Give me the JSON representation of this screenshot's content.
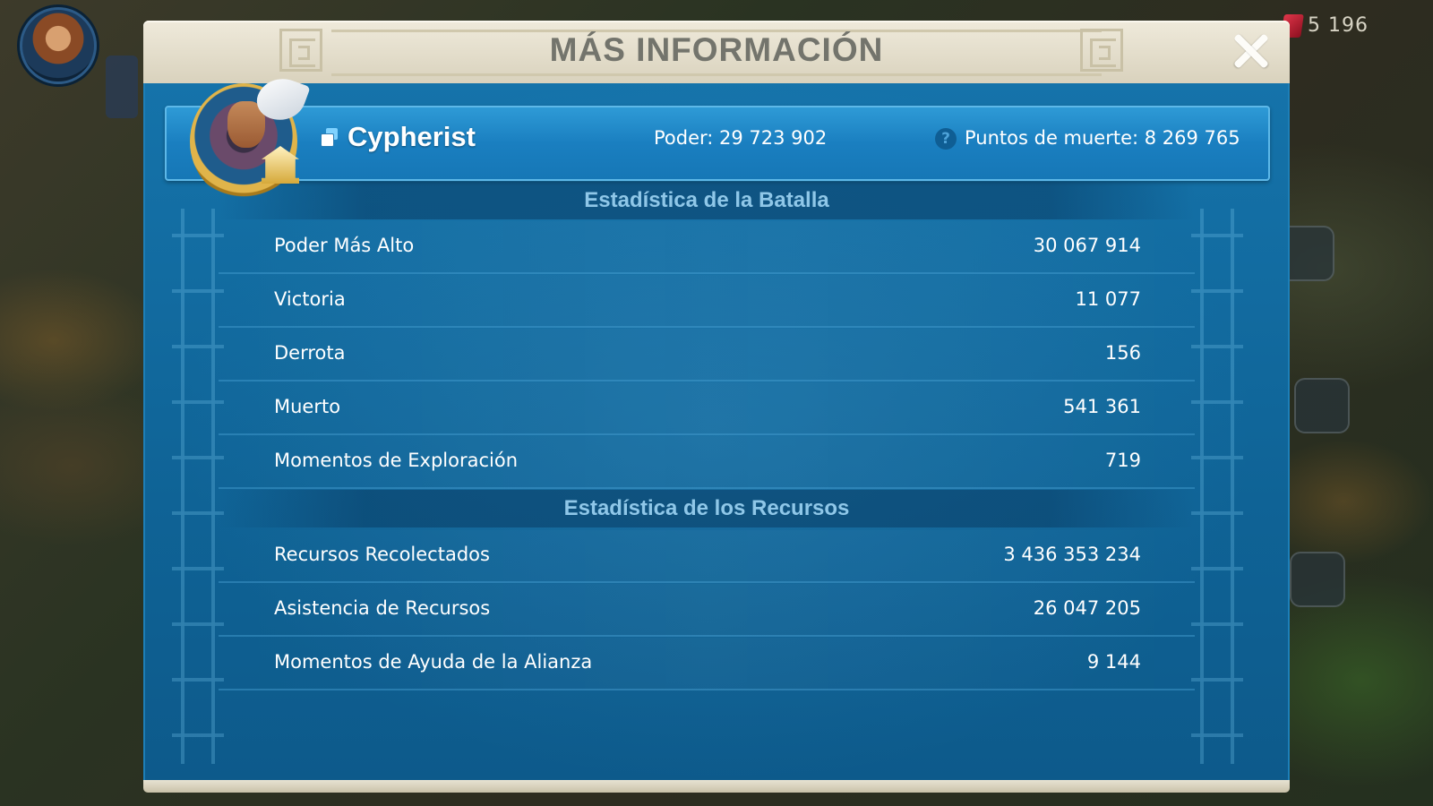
{
  "background": {
    "gem_count": "5 196"
  },
  "dialog": {
    "title": "MÁS INFORMACIÓN"
  },
  "player": {
    "name": "Cypherist",
    "power": "Poder: 29 723 902",
    "kill_points": "Puntos de muerte: 8 269 765",
    "info_icon_glyph": "?"
  },
  "battle_stats": {
    "header": "Estadística de la Batalla",
    "rows": [
      {
        "label": "Poder Más Alto",
        "value": "30 067 914"
      },
      {
        "label": "Victoria",
        "value": "11 077"
      },
      {
        "label": "Derrota",
        "value": "156"
      },
      {
        "label": "Muerto",
        "value": "541 361"
      },
      {
        "label": "Momentos de Exploración",
        "value": "719"
      }
    ]
  },
  "resource_stats": {
    "header": "Estadística de los Recursos",
    "rows": [
      {
        "label": "Recursos Recolectados",
        "value": "3 436 353 234"
      },
      {
        "label": "Asistencia de Recursos",
        "value": "26 047 205"
      },
      {
        "label": "Momentos de Ayuda de la Alianza",
        "value": "9 144"
      }
    ]
  },
  "colors": {
    "panel_blue": "#1573aa",
    "header_parchment": "#e6e0cd",
    "title_gray": "#73746c",
    "section_header_text": "#8fc7e8"
  }
}
